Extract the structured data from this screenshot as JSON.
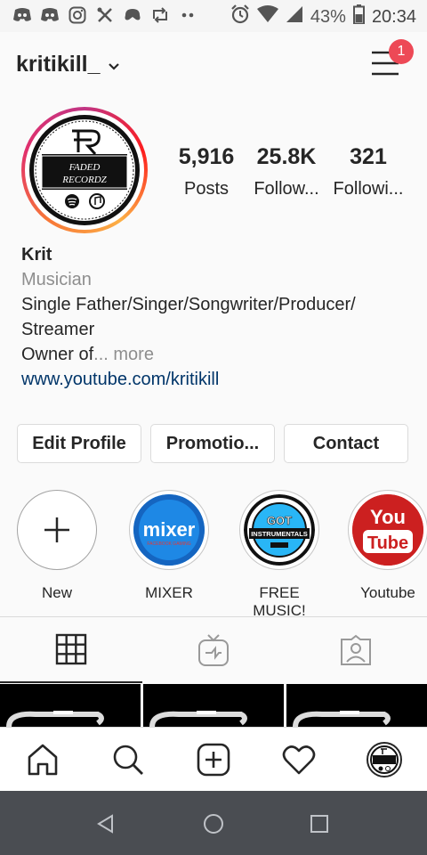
{
  "status_bar": {
    "time": "20:34",
    "battery": "43%"
  },
  "profile": {
    "username": "kritikill_",
    "notification_count": "1",
    "stats": [
      {
        "value": "5,916",
        "label": "Posts"
      },
      {
        "value": "25.8K",
        "label": "Follow..."
      },
      {
        "value": "321",
        "label": "Followi..."
      }
    ],
    "avatar": {
      "brand": "FADED RECORDZ",
      "badges": [
        "spotify",
        "itunes"
      ]
    },
    "bio": {
      "name": "Krit",
      "category": "Musician",
      "line1": "Single Father/Singer/Songwriter/Producer/",
      "line2": "Streamer",
      "line3_start": "Owner of",
      "line3_more": "... more",
      "link": "www.youtube.com/kritikill"
    }
  },
  "buttons": {
    "edit": "Edit Profile",
    "promotions": "Promotio...",
    "contact": "Contact"
  },
  "highlights": [
    {
      "label": "New"
    },
    {
      "label": "MIXER",
      "cover_text": "mixer",
      "cover_sub": "FACEBOOK GAMING"
    },
    {
      "label": "FREE MUSIC!",
      "cover_text": "GOT",
      "cover_sub": "INSTRUMENTALS"
    },
    {
      "label": "Youtube",
      "cover_text": "You",
      "cover_sub": "Tube"
    }
  ],
  "colors": {
    "accent": "#ed4956",
    "link": "#003569",
    "secondary": "#8e8e8e",
    "youtube_red": "#cc2020",
    "mixer_blue": "#1e88e5"
  }
}
